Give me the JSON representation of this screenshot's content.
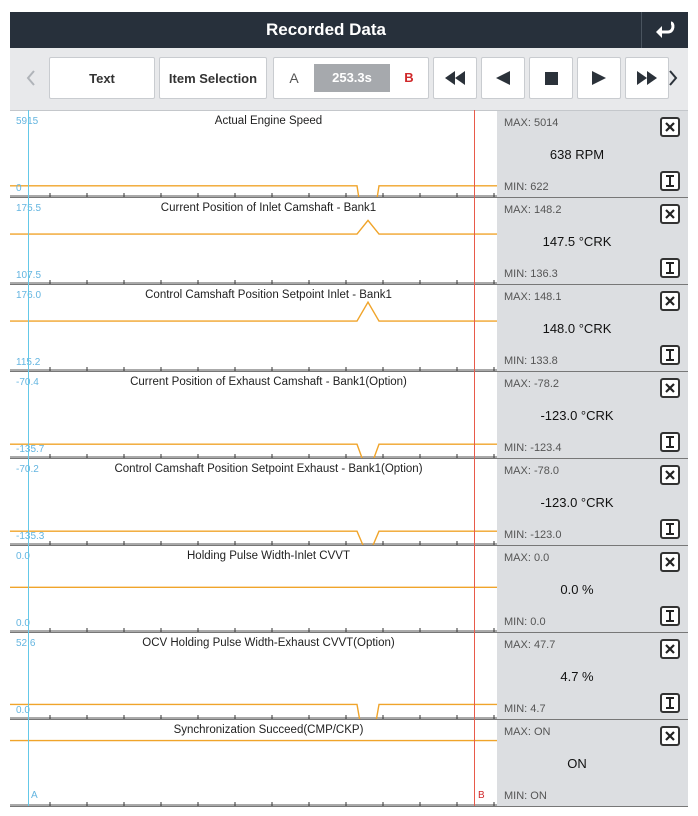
{
  "header": {
    "title": "Recorded Data"
  },
  "toolbar": {
    "text_label": "Text",
    "item_selection_label": "Item Selection",
    "a_label": "A",
    "time": "253.3s",
    "b_label": "B"
  },
  "colors": {
    "accent_line": "#f0a42a",
    "cursor_a": "#64c8e8",
    "cursor_b": "#e85a4a",
    "header_bg": "#27303b"
  },
  "markers": {
    "a": "A",
    "b": "B"
  },
  "panels": [
    {
      "name": "Actual Engine Speed",
      "axis_max": "5915",
      "axis_min": "0",
      "max": "MAX: 5014",
      "min": "MIN: 622",
      "value": "638 RPM",
      "base": 0.87,
      "dir": -1,
      "height": 0.82
    },
    {
      "name": "Current Position of Inlet Camshaft - Bank1",
      "axis_max": "175.5",
      "axis_min": "107.5",
      "max": "MAX: 148.2",
      "min": "MIN: 136.3",
      "value": "147.5 °CRK",
      "base": 0.42,
      "dir": 1,
      "height": 0.16
    },
    {
      "name": "Control Camshaft Position Setpoint Inlet - Bank1",
      "axis_max": "176.0",
      "axis_min": "115.2",
      "max": "MAX: 148.1",
      "min": "MIN: 133.8",
      "value": "148.0 °CRK",
      "base": 0.42,
      "dir": 1,
      "height": 0.22
    },
    {
      "name": "Current Position of Exhaust Camshaft - Bank1(Option)",
      "axis_max": "-70.4",
      "axis_min": "-135.7",
      "max": "MAX: -78.2",
      "min": "MIN: -123.4",
      "value": "-123.0 °CRK",
      "base": 0.84,
      "dir": -1,
      "height": 0.35
    },
    {
      "name": "Control Camshaft Position Setpoint Exhaust - Bank1(Option)",
      "axis_max": "-70.2",
      "axis_min": "-135.3",
      "max": "MAX: -78.0",
      "min": "MIN: -123.0",
      "value": "-123.0 °CRK",
      "base": 0.84,
      "dir": -1,
      "height": 0.3
    },
    {
      "name": "Holding Pulse Width-Inlet CVVT",
      "axis_max": "0.0",
      "axis_min": "0.0",
      "max": "MAX: 0.0",
      "min": "MIN: 0.0",
      "value": "0.0 %",
      "base": 0.48,
      "dir": 0,
      "height": 0
    },
    {
      "name": "OCV Holding Pulse Width-Exhaust CVVT(Option)",
      "axis_max": "52.6",
      "axis_min": "0.0",
      "max": "MAX: 47.7",
      "min": "MIN: 4.7",
      "value": "4.7 %",
      "base": 0.83,
      "dir": -1,
      "height": 0.73
    },
    {
      "name": "Synchronization Succeed(CMP/CKP)",
      "axis_max": "",
      "axis_min": "",
      "max": "MAX: ON",
      "min": "MIN: ON",
      "value": "ON",
      "base": 0.24,
      "dir": 0,
      "height": 0
    }
  ]
}
